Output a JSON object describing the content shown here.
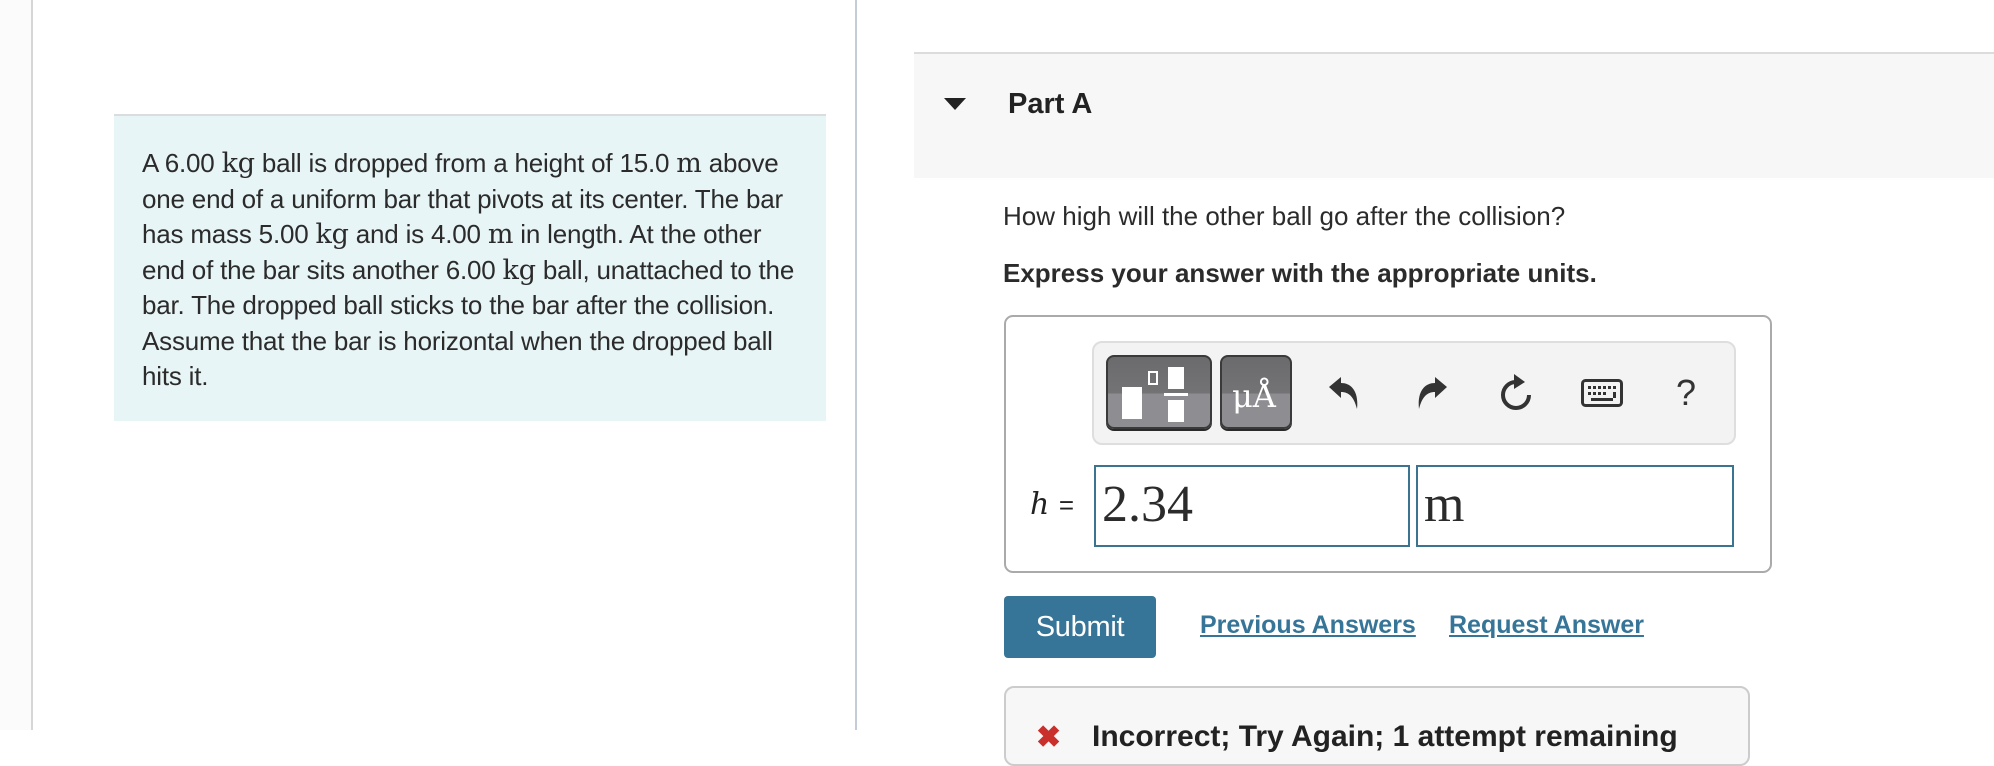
{
  "problem": {
    "segments": [
      {
        "t": "A 6.00 "
      },
      {
        "u": "kg"
      },
      {
        "t": " ball is dropped from a height of 15.0 "
      },
      {
        "u": "m"
      },
      {
        "t": " above one end of a uniform bar that pivots at its center. The bar has mass 5.00 "
      },
      {
        "u": "kg"
      },
      {
        "t": " and is 4.00 "
      },
      {
        "u": "m"
      },
      {
        "t": " in length. At the other end of the bar sits another 6.00 "
      },
      {
        "u": "kg"
      },
      {
        "t": " ball, unattached to the bar. The dropped ball sticks to the bar after the collision. Assume that the bar is horizontal when the dropped ball hits it."
      }
    ]
  },
  "part": {
    "title": "Part A",
    "question": "How high will the other ball go after the collision?",
    "instruction": "Express your answer with the appropriate units."
  },
  "toolbar": {
    "units_label": "μÅ",
    "help_label": "?"
  },
  "answer": {
    "variable": "h",
    "equals": "=",
    "value": "2.34",
    "unit": "m"
  },
  "actions": {
    "submit": "Submit",
    "previous_answers": "Previous Answers",
    "request_answer": "Request Answer"
  },
  "feedback": {
    "icon": "✖",
    "text": "Incorrect; Try Again; 1 attempt remaining"
  },
  "colors": {
    "accent": "#367597",
    "problem_bg": "#e8f5f6",
    "error": "#c9302c"
  }
}
